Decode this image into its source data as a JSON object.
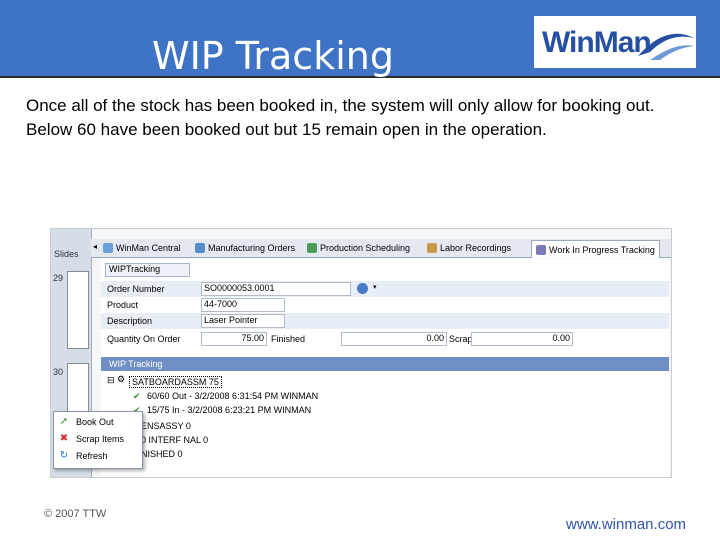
{
  "slide": {
    "title": "WIP Tracking",
    "logo_text": "WinMan",
    "body": "Once all of the stock has been booked in, the system will only allow for booking out.  Below 60 have been booked out but 15 remain open in the operation.",
    "footer_left": "© 2007 TTW",
    "footer_right": "www.winman.com"
  },
  "app": {
    "slides_label": "Slides",
    "slide_nums": [
      "29",
      "30"
    ],
    "tabs": [
      {
        "label": "WinMan Central",
        "icon": "home-icon"
      },
      {
        "label": "Manufacturing Orders",
        "icon": "people-icon"
      },
      {
        "label": "Production Scheduling",
        "icon": "chart-icon"
      },
      {
        "label": "Labor Recordings",
        "icon": "clock-icon"
      },
      {
        "label": "Work In Progress Tracking",
        "icon": "wip-icon"
      }
    ],
    "form": {
      "header": "WIPTracking",
      "order_number_label": "Order Number",
      "order_number_value": "SO0000053.0001",
      "product_label": "Product",
      "product_value": "44-7000",
      "description_label": "Description",
      "description_value": "Laser Pointer",
      "qty_label": "Quantity On Order",
      "qty_value": "75.00",
      "finished_label": "Finished",
      "finished_value": "0.00",
      "scrapped_label": "Scrapped",
      "scrapped_value": "0.00"
    },
    "wip_bar": "WIP Tracking",
    "tree": {
      "root": "SATBOARDASSM 75",
      "line1": "60/60 Out - 3/2/2008 6:31:54 PM WINMAN",
      "line2": "15/75 In - 3/2/2008 6:23:21 PM WINMAN",
      "line3": "ENSASSY 0",
      "line4": "0 INTERF NAL 0",
      "line5": "NISHED 0"
    },
    "context_menu": {
      "book_out": "Book Out",
      "scrap_items": "Scrap Items",
      "refresh": "Refresh"
    }
  },
  "colors": {
    "header_bg": "#3f73c5",
    "link": "#2f56a8"
  }
}
